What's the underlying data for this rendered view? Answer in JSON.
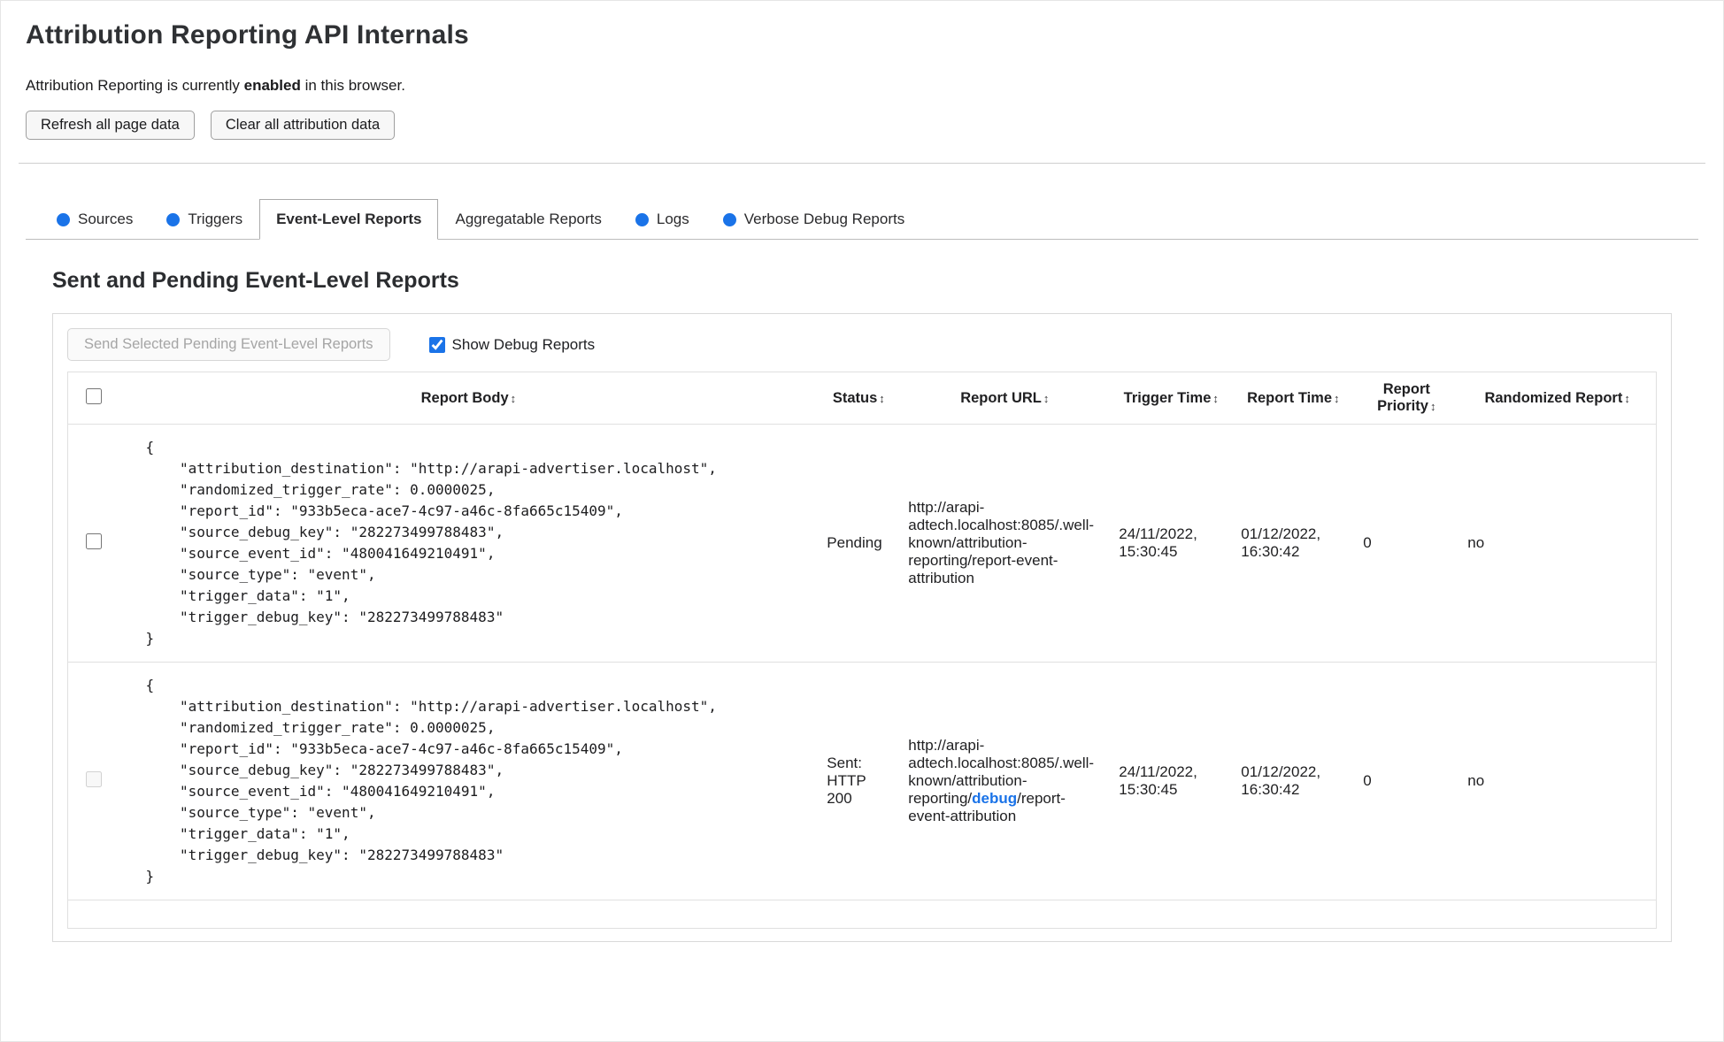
{
  "page": {
    "title": "Attribution Reporting API Internals",
    "status_prefix": "Attribution Reporting is currently ",
    "status_bold": "enabled",
    "status_suffix": " in this browser."
  },
  "toolbar": {
    "refresh_label": "Refresh all page data",
    "clear_label": "Clear all attribution data"
  },
  "tabs": [
    {
      "label": "Sources",
      "has_new_data_dot": true,
      "active": false
    },
    {
      "label": "Triggers",
      "has_new_data_dot": true,
      "active": false
    },
    {
      "label": "Event-Level Reports",
      "has_new_data_dot": false,
      "active": true
    },
    {
      "label": "Aggregatable Reports",
      "has_new_data_dot": false,
      "active": false
    },
    {
      "label": "Logs",
      "has_new_data_dot": true,
      "active": false
    },
    {
      "label": "Verbose Debug Reports",
      "has_new_data_dot": true,
      "active": false
    }
  ],
  "section": {
    "heading": "Sent and Pending Event-Level Reports",
    "send_button_label": "Send Selected Pending Event-Level Reports",
    "send_button_disabled": true,
    "show_debug_label": "Show Debug Reports",
    "show_debug_checked": true
  },
  "colors": {
    "accent_blue": "#1a73e8",
    "debug_link_blue": "#1a73e8"
  },
  "table": {
    "sort_icon": "↕",
    "select_all_checked": false,
    "headers": [
      "Report Body",
      "Status",
      "Report URL",
      "Trigger Time",
      "Report Time",
      "Report Priority",
      "Randomized Report"
    ],
    "rows": [
      {
        "selected": false,
        "checkbox_disabled": false,
        "report_body": "{\n    \"attribution_destination\": \"http://arapi-advertiser.localhost\",\n    \"randomized_trigger_rate\": 0.0000025,\n    \"report_id\": \"933b5eca-ace7-4c97-a46c-8fa665c15409\",\n    \"source_debug_key\": \"282273499788483\",\n    \"source_event_id\": \"480041649210491\",\n    \"source_type\": \"event\",\n    \"trigger_data\": \"1\",\n    \"trigger_debug_key\": \"282273499788483\"\n}",
        "status": "Pending",
        "report_url_before": "http://arapi-adtech.localhost:8085/.well-known/attribution-reporting/report-event-attribution",
        "report_url_debug": "",
        "report_url_after": "",
        "trigger_time": "24/11/2022, 15:30:45",
        "report_time": "01/12/2022, 16:30:42",
        "report_priority": "0",
        "randomized_report": "no"
      },
      {
        "selected": false,
        "checkbox_disabled": true,
        "report_body": "{\n    \"attribution_destination\": \"http://arapi-advertiser.localhost\",\n    \"randomized_trigger_rate\": 0.0000025,\n    \"report_id\": \"933b5eca-ace7-4c97-a46c-8fa665c15409\",\n    \"source_debug_key\": \"282273499788483\",\n    \"source_event_id\": \"480041649210491\",\n    \"source_type\": \"event\",\n    \"trigger_data\": \"1\",\n    \"trigger_debug_key\": \"282273499788483\"\n}",
        "status": "Sent: HTTP 200",
        "report_url_before": "http://arapi-adtech.localhost:8085/.well-known/attribution-reporting/",
        "report_url_debug": "debug",
        "report_url_after": "/report-event-attribution",
        "trigger_time": "24/11/2022, 15:30:45",
        "report_time": "01/12/2022, 16:30:42",
        "report_priority": "0",
        "randomized_report": "no"
      }
    ]
  }
}
